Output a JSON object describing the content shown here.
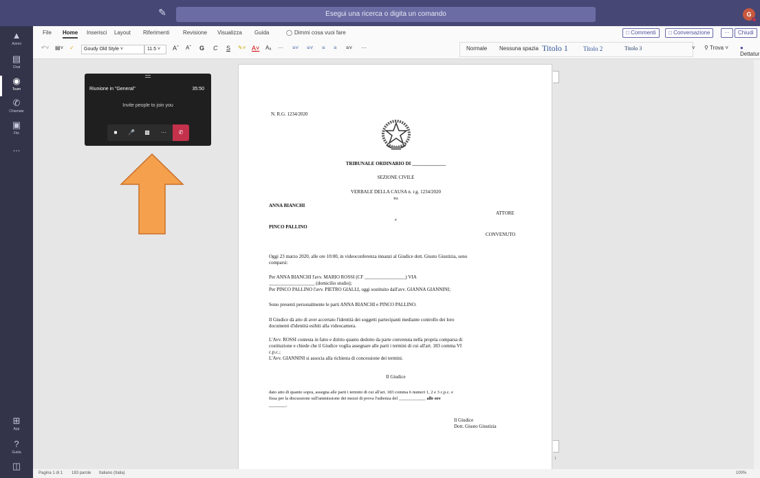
{
  "search": {
    "placeholder": "Esegui una ricerca o digita un comando"
  },
  "user": {
    "initial": "G"
  },
  "rail": [
    {
      "label": "Azioni",
      "icon": "bell-icon"
    },
    {
      "label": "Chat",
      "icon": "chat-icon"
    },
    {
      "label": "Team",
      "icon": "team-icon"
    },
    {
      "label": "Chiamate",
      "icon": "phone-icon"
    },
    {
      "label": "File",
      "icon": "file-icon"
    },
    {
      "label": "...",
      "icon": "more-icon"
    },
    {
      "label": "App",
      "icon": "apps-icon"
    },
    {
      "label": "Guida",
      "icon": "help-icon"
    }
  ],
  "menu": {
    "file": "File",
    "home": "Home",
    "insert": "Inserisci",
    "layout": "Layout",
    "refs": "Riferimenti",
    "review": "Revisione",
    "view": "Visualizza",
    "help": "Guida",
    "tell": "Dimmi cosa vuoi fare",
    "comments": "Commenti",
    "conversation": "Conversazione",
    "more": "···",
    "close": "Chiudi"
  },
  "toolbar": {
    "font": "Goudy Old Style",
    "size": "11.5",
    "styles": [
      "Normale",
      "Nessuna spazia",
      "Titolo 1",
      "Titolo 2",
      "Titolo 3"
    ],
    "find": "Trova",
    "dictate": "Dettatura"
  },
  "meeting": {
    "title": "Riunione in \"General\"",
    "timer": "35:50",
    "invite": "Invite people to join you"
  },
  "document": {
    "rg": "N. R.G. 1234/2020",
    "court": "TRIBUNALE ORDINARIO DI ______________",
    "section": "SEZIONE CIVILE",
    "verbale": "VERBALE DELLA CAUSA n. r.g. 1234/2020",
    "tra": "tra",
    "party1": "ANNA BIANCHI",
    "role1": "ATTORE",
    "e": "e",
    "party2": "PINCO PALLINO",
    "role2": "CONVENUTO",
    "p1a": "Oggi 23 marzo 2020, alle ore 10:00, in videoconferenza innanzi al Giudice dott. Giusto Giustizia, sono",
    "p1b": "comparsi:",
    "p2a": "Per   ANNA   BIANCHI   l'avv.   MARIO   ROSSI   (CF   _________________)   VIA",
    "p2b": "___________________ (domicilio studio);",
    "p2c": "Per PINCO PALLINO l'avv. PIETRO GIALLI, oggi sostituito dall'avv. GIANNA GIANNINI;",
    "p3": "Sono presenti personalmente le parti ANNA BIANCHI e PINCO PALLINO.",
    "p4a": "Il Giudice dà atto di aver accertato l'identità dei soggetti partecipanti mediante controllo dei loro",
    "p4b": "documenti d'identità esibiti alla videocamera.",
    "p5a": "L'Avv. ROSSI contesta in fatto e diritto quanto dedotto da parte convenuta nella propria comparsa di",
    "p5b": "costituzione e chiede che il Giudice voglia assegnare alle parti i termini di cui all'art. 183 comma VI",
    "p5c": "c.p.c.;",
    "p5d": "L'Avv. GIANNINI si associa alla richiesta di concessione dei termini.",
    "giudice": "Il Giudice",
    "p6a": "dato atto di quanto sopra, assegna alle parti i termini di cui all'art. 183 comma 6 numeri 1, 2 e 3 c.p.c. e",
    "p6b": "fissa per la discussione sull'ammissione dei mezzi di prova l'udienza del ____________",
    "p6b_bold": "alle ore",
    "p6c": "_______.",
    "sign1": "Il Giudice",
    "sign2": "Dott. Giusto Giustizia"
  },
  "page_number": "1",
  "status": {
    "page": "Pagina 1 di 1",
    "words": "183 parole",
    "lang": "Italiano (Italia)",
    "zoom": "100%"
  }
}
